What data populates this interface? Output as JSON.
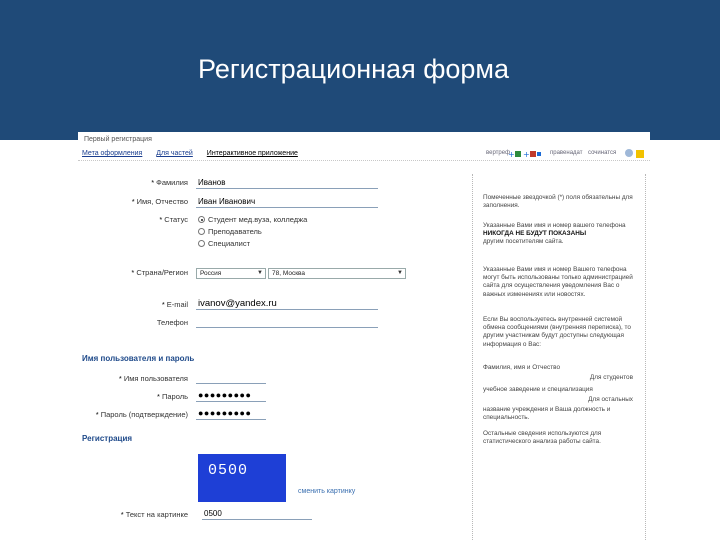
{
  "slide": {
    "title": "Регистрационная форма"
  },
  "screen": {
    "breadcrumb": "Первый регистрация",
    "nav": [
      "Мета оформления",
      "Для частей",
      "Интерактивное приложение"
    ],
    "icons_area": {
      "label_left": "вертреф",
      "label_mid": "правенадат",
      "label_right": "сочинатся"
    },
    "form": {
      "surname": {
        "label": "Фамилия",
        "value": "Иванов"
      },
      "name": {
        "label": "Имя, Отчество",
        "value": "Иван Иванович"
      },
      "status": {
        "label": "Статус",
        "options": [
          "Студент мед.вуза, колледжа",
          "Преподаватель",
          "Специалист"
        ],
        "selected": 0
      },
      "country": {
        "label": "Страна/Регион",
        "country_value": "Россия",
        "city_value": "78, Москва"
      },
      "email": {
        "label": "E-mail",
        "value": "ivanov@yandex.ru"
      },
      "phone": {
        "label": "Телефон",
        "value": ""
      }
    },
    "account": {
      "heading": "Имя пользователя и пароль",
      "username": {
        "label": "Имя пользователя",
        "value": ""
      },
      "password": {
        "label": "Пароль",
        "value": "●●●●●●●●●"
      },
      "confirm": {
        "label": "Пароль (подтверждение)",
        "value": "●●●●●●●●●"
      }
    },
    "registration": {
      "heading": "Регистрация",
      "captcha_code": "0500",
      "change_link": "сменить картинку",
      "captcha_input": {
        "label": "Текст на картинке",
        "value": "0500"
      }
    },
    "help": {
      "p1": "Помеченные звездочкой (*) поля обязательны для заполнения.",
      "p2_a": "Указанные Вами ",
      "p2_b": "имя и номер вашего телефона",
      "p2_c": "НИКОГДА НЕ БУДУТ ПОКАЗАНЫ",
      "p2_d": "другим посетителям сайта.",
      "p3": "Указанные Вами имя и номер Вашего телефона могут быть использованы только администрацией сайта для осуществления уведомления Вас о важных изменениях или новостях.",
      "p4": "Если Вы воспользуетесь внутренней системой обмена сообщениями (внутренняя переписка), то другим участникам будут доступны следующая информация о Вас:",
      "p5_label": "Фамилия, имя и Отчество",
      "p5_value": "Для студентов",
      "p6_label": "учебное заведение и специализация",
      "p6_value": "Для остальных",
      "p7": "название учреждения и Ваша должность и специальность.",
      "p8": "Остальные сведения используются для статистического анализа работы сайта."
    }
  }
}
